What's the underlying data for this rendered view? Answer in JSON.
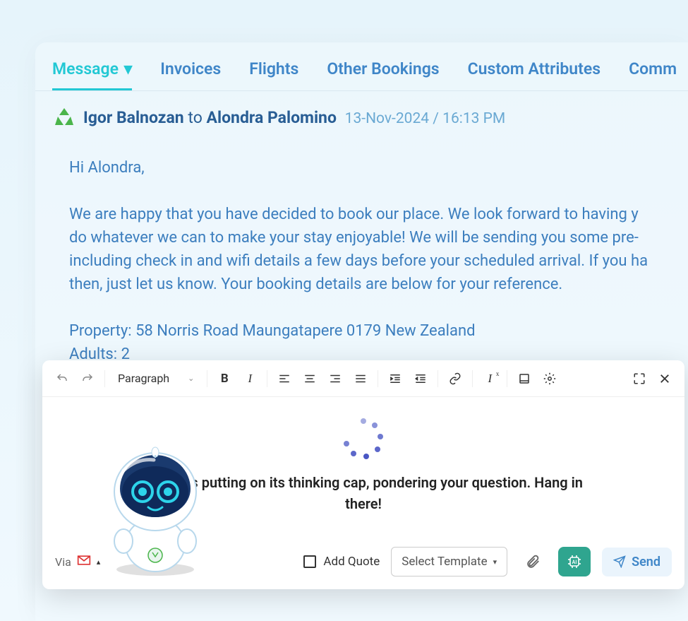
{
  "tabs": {
    "items": [
      {
        "label": "Message",
        "active": true
      },
      {
        "label": "Invoices",
        "active": false
      },
      {
        "label": "Flights",
        "active": false
      },
      {
        "label": "Other Bookings",
        "active": false
      },
      {
        "label": "Custom Attributes",
        "active": false
      },
      {
        "label": "Comm",
        "active": false
      }
    ]
  },
  "header": {
    "from": "Igor Balnozan",
    "to_label": "to",
    "to": "Alondra Palomino",
    "timestamp": "13-Nov-2024 / 16:13 PM"
  },
  "message": {
    "greeting": "Hi Alondra,",
    "body": "We are happy that you have decided to book our place. We look forward to having y\ndo whatever we can to make your stay enjoyable! We will be sending you some pre-\nincluding check in and wifi details a few days before your scheduled arrival. If you ha\nthen, just let us know. Your booking details are below for your reference.",
    "property_line": "Property: 58 Norris Road Maungatapere 0179 New Zealand",
    "adults_line": "Adults: 2"
  },
  "editor": {
    "style_select": "Paragraph",
    "ai_status": "Our AI is putting on its thinking cap, pondering your question. Hang in there!"
  },
  "footer": {
    "via_label": "Via",
    "add_quote_label": "Add Quote",
    "select_template_label": "Select Template",
    "send_label": "Send"
  }
}
